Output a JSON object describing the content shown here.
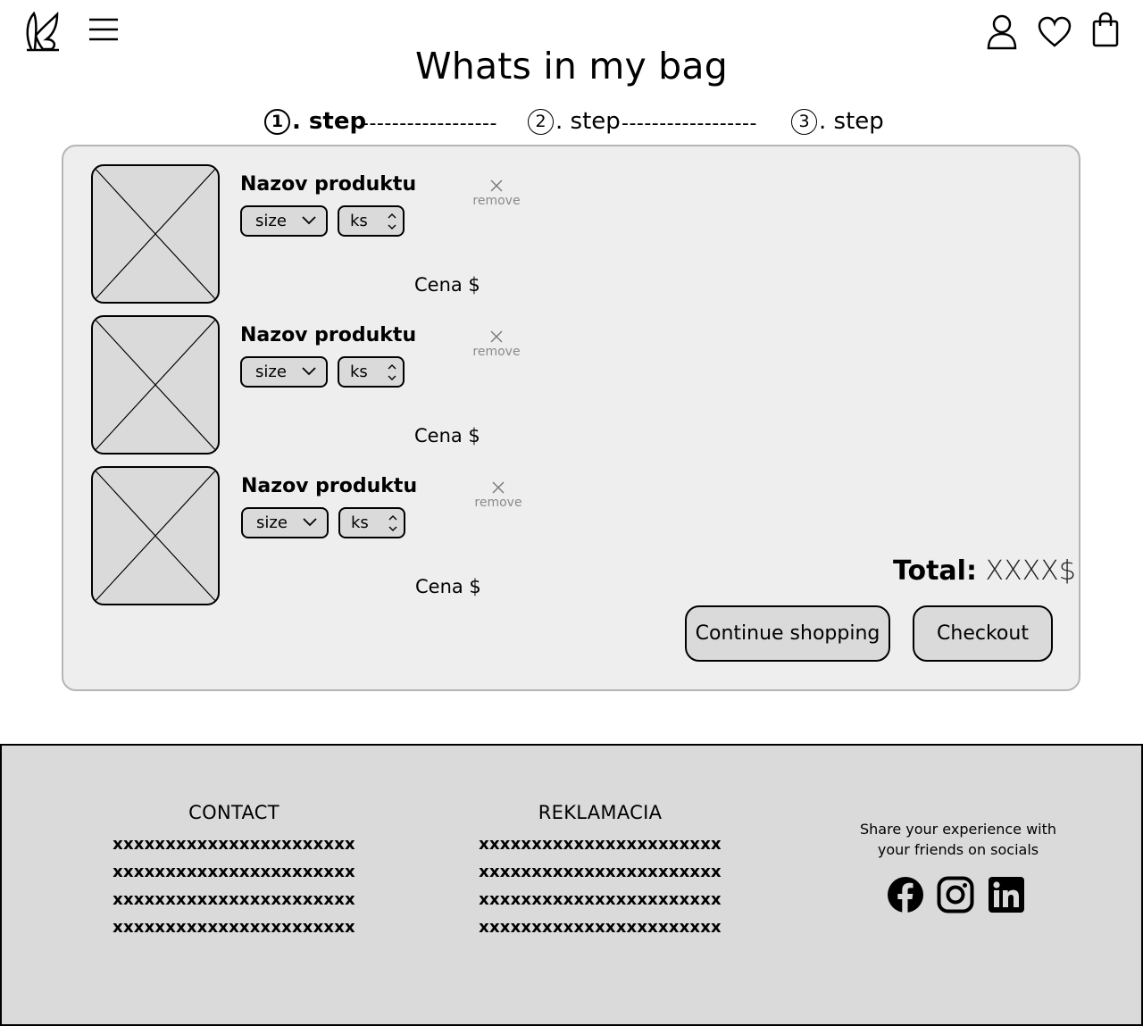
{
  "header": {
    "title": "Whats in my bag",
    "icons": [
      "logo-icon",
      "menu-icon",
      "user-icon",
      "heart-icon",
      "bag-icon"
    ]
  },
  "steps": [
    {
      "number": "1",
      "label": ". step",
      "active": true
    },
    {
      "number": "2",
      "label": ". step",
      "active": false
    },
    {
      "number": "3",
      "label": ". step",
      "active": false
    }
  ],
  "step_separator": "------------------",
  "cart": {
    "items": [
      {
        "name": "Nazov produktu",
        "size": "size",
        "qty": "ks",
        "remove": "remove",
        "price": "Cena $"
      },
      {
        "name": "Nazov produktu",
        "size": "size",
        "qty": "ks",
        "remove": "remove",
        "price": "Cena $"
      },
      {
        "name": "Nazov produktu",
        "size": "size",
        "qty": "ks",
        "remove": "remove",
        "price": "Cena $"
      }
    ],
    "total_label": "Total:",
    "total_value": "XXXX$",
    "continue_label": "Continue shopping",
    "checkout_label": "Checkout"
  },
  "footer": {
    "contact": {
      "title": "CONTACT",
      "lines": [
        "xxxxxxxxxxxxxxxxxxxxxxx",
        "xxxxxxxxxxxxxxxxxxxxxxx",
        "xxxxxxxxxxxxxxxxxxxxxxx",
        "xxxxxxxxxxxxxxxxxxxxxxx"
      ]
    },
    "reklamacia": {
      "title": "REKLAMACIA",
      "lines": [
        "xxxxxxxxxxxxxxxxxxxxxxx",
        "xxxxxxxxxxxxxxxxxxxxxxx",
        "xxxxxxxxxxxxxxxxxxxxxxx",
        "xxxxxxxxxxxxxxxxxxxxxxx"
      ]
    },
    "social": {
      "text_line1": "Share your experience with",
      "text_line2": "your friends on socials",
      "icons": [
        "facebook-icon",
        "instagram-icon",
        "linkedin-icon"
      ]
    }
  },
  "colors": {
    "panel_bg": "#eeeeee",
    "panel_border": "#b5b5b5",
    "control_bg": "#dadada",
    "footer_bg": "#dadada",
    "muted_text": "#8a8a8a"
  }
}
